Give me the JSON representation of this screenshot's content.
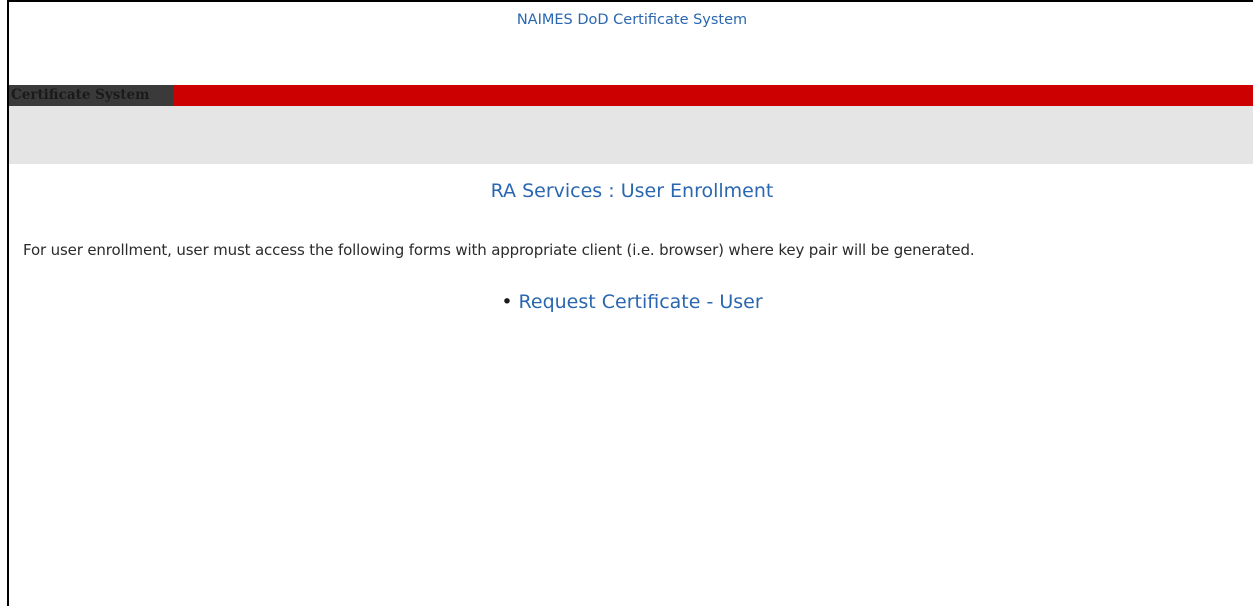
{
  "header": {
    "title": "NAIMES DoD Certificate System"
  },
  "banner": {
    "label": "Certificate System"
  },
  "main": {
    "heading_section": "RA Services",
    "heading_separator": ":",
    "heading_page": "User Enrollment",
    "description": "For user enrollment, user must access the following forms with appropriate client (i.e. browser) where key pair will be generated.",
    "links": [
      {
        "bullet": "•",
        "label": "Request Certificate - User"
      }
    ]
  },
  "colors": {
    "link_blue": "#2a67b0",
    "banner_red": "#cc0000",
    "band_gray": "#e5e5e5"
  }
}
